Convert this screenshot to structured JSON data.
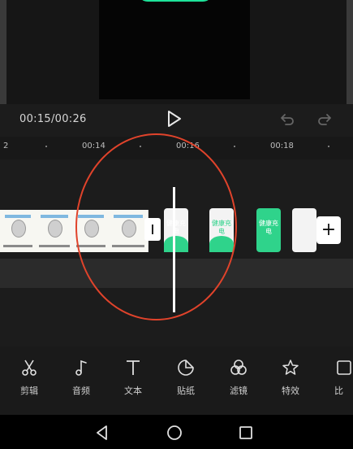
{
  "player": {
    "timecode": "00:15/00:26"
  },
  "ruler": {
    "ticks": [
      "2",
      "00:14",
      "00:16",
      "00:18"
    ]
  },
  "timeline": {
    "clip_text": "健康充电"
  },
  "toolbar": {
    "items": [
      {
        "label": "剪辑",
        "icon": "scissors-icon"
      },
      {
        "label": "音频",
        "icon": "music-note-icon"
      },
      {
        "label": "文本",
        "icon": "text-icon"
      },
      {
        "label": "贴纸",
        "icon": "sticker-icon"
      },
      {
        "label": "滤镜",
        "icon": "filter-icon"
      },
      {
        "label": "特效",
        "icon": "effects-icon"
      },
      {
        "label": "比",
        "icon": "ratio-icon"
      }
    ]
  },
  "colors": {
    "accent": "#1ee39a",
    "annotation": "#e0432b"
  }
}
